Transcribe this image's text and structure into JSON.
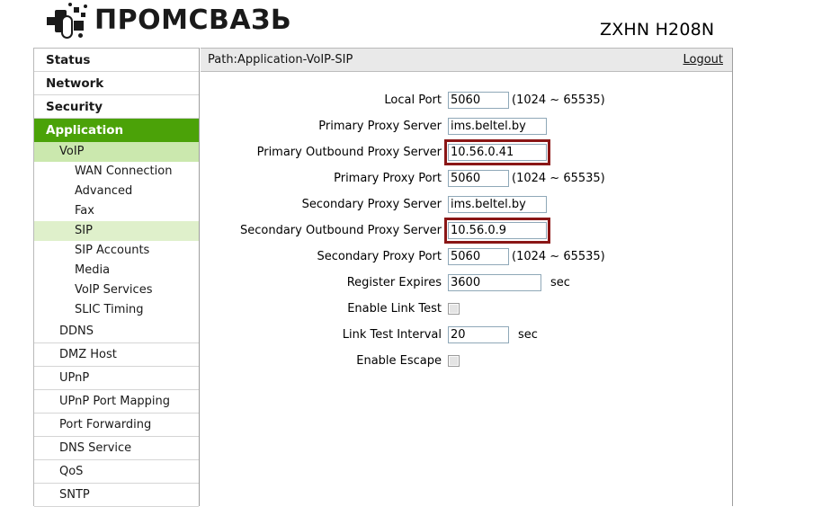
{
  "header": {
    "logo_text": "ПРОМСВАЗЬ",
    "logo_icon": "promsvyaz-logo-icon",
    "model_name": "ZXHN H208N"
  },
  "sidebar": {
    "top_items": [
      {
        "label": "Status",
        "active": false
      },
      {
        "label": "Network",
        "active": false
      },
      {
        "label": "Security",
        "active": false
      },
      {
        "label": "Application",
        "active": true
      }
    ],
    "voip": {
      "label": "VoIP",
      "selected": true
    },
    "voip_children": [
      {
        "label": "WAN Connection",
        "selected": false
      },
      {
        "label": "Advanced",
        "selected": false
      },
      {
        "label": "Fax",
        "selected": false
      },
      {
        "label": "SIP",
        "selected": true
      },
      {
        "label": "SIP Accounts",
        "selected": false
      },
      {
        "label": "Media",
        "selected": false
      },
      {
        "label": "VoIP Services",
        "selected": false
      },
      {
        "label": "SLIC Timing",
        "selected": false
      }
    ],
    "bottom_items": [
      {
        "label": "DDNS"
      },
      {
        "label": "DMZ Host"
      },
      {
        "label": "UPnP"
      },
      {
        "label": "UPnP Port Mapping"
      },
      {
        "label": "Port Forwarding"
      },
      {
        "label": "DNS Service"
      },
      {
        "label": "QoS"
      },
      {
        "label": "SNTP"
      }
    ]
  },
  "pathbar": {
    "path": "Path:Application-VoIP-SIP",
    "logout": "Logout"
  },
  "form": {
    "local_port": {
      "label": "Local Port",
      "value": "5060",
      "hint": "(1024 ~ 65535)"
    },
    "primary_proxy_server": {
      "label": "Primary Proxy Server",
      "value": "ims.beltel.by"
    },
    "primary_outbound_proxy_server": {
      "label": "Primary Outbound Proxy Server",
      "value": "10.56.0.41"
    },
    "primary_proxy_port": {
      "label": "Primary Proxy Port",
      "value": "5060",
      "hint": "(1024 ~ 65535)"
    },
    "secondary_proxy_server": {
      "label": "Secondary Proxy Server",
      "value": "ims.beltel.by"
    },
    "secondary_outbound_proxy_server": {
      "label": "Secondary Outbound Proxy Server",
      "value": "10.56.0.9"
    },
    "secondary_proxy_port": {
      "label": "Secondary Proxy Port",
      "value": "5060",
      "hint": "(1024 ~ 65535)"
    },
    "register_expires": {
      "label": "Register Expires",
      "value": "3600",
      "unit": "sec"
    },
    "enable_link_test": {
      "label": "Enable Link Test",
      "checked": false
    },
    "link_test_interval": {
      "label": "Link Test Interval",
      "value": "20",
      "unit": "sec"
    },
    "enable_escape": {
      "label": "Enable Escape",
      "checked": false
    }
  },
  "annotations": {
    "color": "#8a1616",
    "highlighted_fields": [
      "primary_outbound_proxy_server",
      "secondary_outbound_proxy_server"
    ]
  },
  "colors": {
    "nav_active_green": "#4ba208",
    "nav_selected_green": "#cbe8ae",
    "nav_child_selected_green": "#dff0cb",
    "pathbar_gray": "#e9e9e9"
  }
}
